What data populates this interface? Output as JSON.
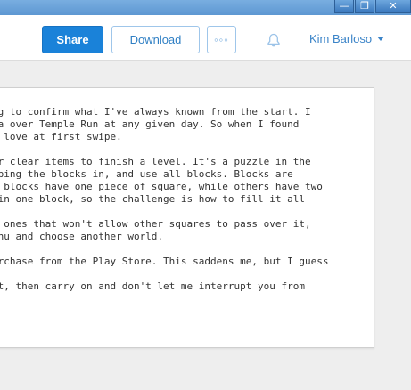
{
  "window_controls": {
    "minimize": "—",
    "maximize": "❐",
    "close": "✕"
  },
  "toolbar": {
    "share_label": "Share",
    "download_label": "Download",
    "more_label": "◦◦◦",
    "bell_icon": "bell-icon",
    "user_name": "Kim Barloso"
  },
  "document": {
    "paragraphs": [
      [
        "ng to confirm what I've always known from the start. I",
        "ga over Temple Run at any given day. So when I found",
        "s love at first swipe."
      ],
      [
        "or clear items to finish a level. It's a puzzle in the",
        "iping the blocks in, and use all blocks. Blocks are",
        "e blocks have one piece of square, while others have two",
        " in one block, so the challenge is how to fill it all"
      ],
      [
        "e ones that won't allow other squares to pass over it,",
        "enu and choose another world."
      ],
      [
        "urchase from the Play Store. This saddens me, but I guess"
      ],
      [
        "pt, then carry on and don't let me interrupt you from"
      ]
    ]
  }
}
